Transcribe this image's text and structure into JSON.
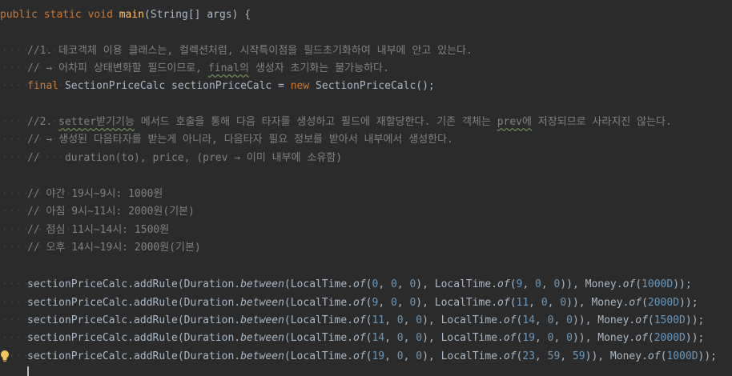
{
  "editor": {
    "signature": {
      "kw1": "public",
      "kw2": "static",
      "kw3": "void",
      "name": "main",
      "params": "(String[] args) {"
    },
    "comments_block1": [
      "//1. 데코객체 이용 클래스는, 컬렉션처럼, 시작특이점을 필드초기화하여 내부에 안고 있는다.",
      "// → 어차피 상태변화할 필드이므로, ",
      "final의",
      " 생성자 초기화는 불가능하다."
    ],
    "final_decl": {
      "kw_final": "final",
      "type_and_name": " SectionPriceCalc sectionPriceCalc = ",
      "kw_new": "new",
      "ctor": " SectionPriceCalc();"
    },
    "comments_block2": {
      "line1_pre": "//2. ",
      "line1_wavy1": "setter받기기능",
      "line1_mid": " 메서드 호출을 통해 다음 타자를 생성하고 필드에 재할당한다. 기존 객체는 ",
      "line1_wavy2": "prev에",
      "line1_post": " 저장되므로 사라지진 않는다.",
      "line2": "// → 생성된 다음타자를 받는게 아니라, 다음타자 필요 정보를 받아서 내부에서 생성한다.",
      "line3": "//    duration(to), price, (prev → 이미 내부에 소유함)"
    },
    "rate_comments": [
      "// 야간 19시~9시: 1000원",
      "// 아침 9시~11시: 2000원(기본)",
      "// 점심 11시~14시: 1500원",
      "// 오후 14시~19시: 2000원(기본)"
    ],
    "rules": [
      {
        "a": [
          "0",
          "0",
          "0"
        ],
        "b": [
          "9",
          "0",
          "0"
        ],
        "money": "1000D"
      },
      {
        "a": [
          "9",
          "0",
          "0"
        ],
        "b": [
          "11",
          "0",
          "0"
        ],
        "money": "2000D"
      },
      {
        "a": [
          "11",
          "0",
          "0"
        ],
        "b": [
          "14",
          "0",
          "0"
        ],
        "money": "1500D"
      },
      {
        "a": [
          "14",
          "0",
          "0"
        ],
        "b": [
          "19",
          "0",
          "0"
        ],
        "money": "2000D"
      },
      {
        "a": [
          "19",
          "0",
          "0"
        ],
        "b": [
          "23",
          "59",
          "59"
        ],
        "money": "1000D"
      }
    ],
    "rule_parts": {
      "recv": "sectionPriceCalc.addRule(Duration.",
      "between": "between",
      "lt": "(LocalTime.",
      "of": "of",
      "lt2": ", LocalTime.",
      "money": "), Money.",
      "end": "));",
      "comma": ", ",
      "open": "(",
      "close": ")"
    }
  }
}
